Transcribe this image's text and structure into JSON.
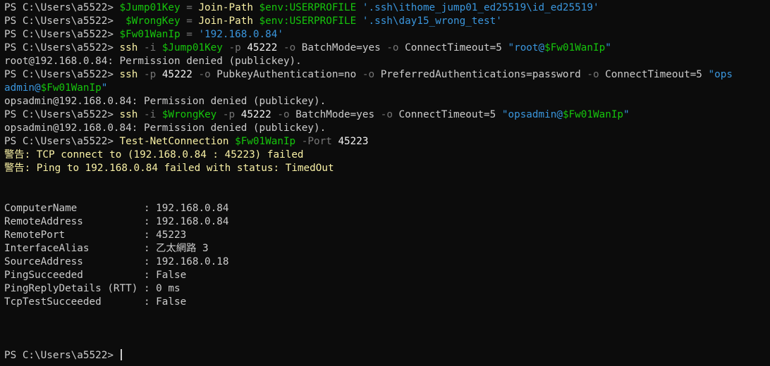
{
  "colors": {
    "background": "#0c0c0c",
    "default": "#cccccc",
    "command": "#f9f1a5",
    "variable": "#16c60c",
    "string": "#3a96dd",
    "operator": "#767676",
    "warning": "#f9f1a5",
    "number": "#f2f2f2"
  },
  "lines": [
    {
      "segs": [
        {
          "t": "PS C:\\Users\\a5522> ",
          "c": "default"
        },
        {
          "t": "$Jump01Key",
          "c": "variable"
        },
        {
          "t": " ",
          "c": "default"
        },
        {
          "t": "=",
          "c": "operator"
        },
        {
          "t": " ",
          "c": "default"
        },
        {
          "t": "Join-Path",
          "c": "command"
        },
        {
          "t": " ",
          "c": "default"
        },
        {
          "t": "$env:USERPROFILE",
          "c": "variable"
        },
        {
          "t": " ",
          "c": "default"
        },
        {
          "t": "'.ssh\\ithome_jump01_ed25519\\id_ed25519'",
          "c": "string"
        }
      ]
    },
    {
      "segs": [
        {
          "t": "PS C:\\Users\\a5522>  ",
          "c": "default"
        },
        {
          "t": "$WrongKey",
          "c": "variable"
        },
        {
          "t": " ",
          "c": "default"
        },
        {
          "t": "=",
          "c": "operator"
        },
        {
          "t": " ",
          "c": "default"
        },
        {
          "t": "Join-Path",
          "c": "command"
        },
        {
          "t": " ",
          "c": "default"
        },
        {
          "t": "$env:USERPROFILE",
          "c": "variable"
        },
        {
          "t": " ",
          "c": "default"
        },
        {
          "t": "'.ssh\\day15_wrong_test'",
          "c": "string"
        }
      ]
    },
    {
      "segs": [
        {
          "t": "PS C:\\Users\\a5522> ",
          "c": "default"
        },
        {
          "t": "$Fw01WanIp",
          "c": "variable"
        },
        {
          "t": " ",
          "c": "default"
        },
        {
          "t": "=",
          "c": "operator"
        },
        {
          "t": " ",
          "c": "default"
        },
        {
          "t": "'192.168.0.84'",
          "c": "string"
        }
      ]
    },
    {
      "segs": [
        {
          "t": "PS C:\\Users\\a5522> ",
          "c": "default"
        },
        {
          "t": "ssh",
          "c": "command"
        },
        {
          "t": " ",
          "c": "default"
        },
        {
          "t": "-i",
          "c": "operator"
        },
        {
          "t": " ",
          "c": "default"
        },
        {
          "t": "$Jump01Key",
          "c": "variable"
        },
        {
          "t": " ",
          "c": "default"
        },
        {
          "t": "-p",
          "c": "operator"
        },
        {
          "t": " ",
          "c": "default"
        },
        {
          "t": "45222",
          "c": "number"
        },
        {
          "t": " ",
          "c": "default"
        },
        {
          "t": "-o",
          "c": "operator"
        },
        {
          "t": " BatchMode=yes ",
          "c": "default"
        },
        {
          "t": "-o",
          "c": "operator"
        },
        {
          "t": " ConnectTimeout=5 ",
          "c": "default"
        },
        {
          "t": "\"root@",
          "c": "string"
        },
        {
          "t": "$Fw01WanIp",
          "c": "variable"
        },
        {
          "t": "\"",
          "c": "string"
        }
      ]
    },
    {
      "segs": [
        {
          "t": "root@192.168.0.84: Permission denied (publickey).",
          "c": "default"
        }
      ]
    },
    {
      "segs": [
        {
          "t": "PS C:\\Users\\a5522> ",
          "c": "default"
        },
        {
          "t": "ssh",
          "c": "command"
        },
        {
          "t": " ",
          "c": "default"
        },
        {
          "t": "-p",
          "c": "operator"
        },
        {
          "t": " ",
          "c": "default"
        },
        {
          "t": "45222",
          "c": "number"
        },
        {
          "t": " ",
          "c": "default"
        },
        {
          "t": "-o",
          "c": "operator"
        },
        {
          "t": " PubkeyAuthentication=no ",
          "c": "default"
        },
        {
          "t": "-o",
          "c": "operator"
        },
        {
          "t": " PreferredAuthentications=password ",
          "c": "default"
        },
        {
          "t": "-o",
          "c": "operator"
        },
        {
          "t": " ConnectTimeout=5 ",
          "c": "default"
        },
        {
          "t": "\"ops",
          "c": "string"
        }
      ]
    },
    {
      "segs": [
        {
          "t": "admin@",
          "c": "string"
        },
        {
          "t": "$Fw01WanIp",
          "c": "variable"
        },
        {
          "t": "\"",
          "c": "string"
        }
      ]
    },
    {
      "segs": [
        {
          "t": "opsadmin@192.168.0.84: Permission denied (publickey).",
          "c": "default"
        }
      ]
    },
    {
      "segs": [
        {
          "t": "PS C:\\Users\\a5522> ",
          "c": "default"
        },
        {
          "t": "ssh",
          "c": "command"
        },
        {
          "t": " ",
          "c": "default"
        },
        {
          "t": "-i",
          "c": "operator"
        },
        {
          "t": " ",
          "c": "default"
        },
        {
          "t": "$WrongKey",
          "c": "variable"
        },
        {
          "t": " ",
          "c": "default"
        },
        {
          "t": "-p",
          "c": "operator"
        },
        {
          "t": " ",
          "c": "default"
        },
        {
          "t": "45222",
          "c": "number"
        },
        {
          "t": " ",
          "c": "default"
        },
        {
          "t": "-o",
          "c": "operator"
        },
        {
          "t": " BatchMode=yes ",
          "c": "default"
        },
        {
          "t": "-o",
          "c": "operator"
        },
        {
          "t": " ConnectTimeout=5 ",
          "c": "default"
        },
        {
          "t": "\"opsadmin@",
          "c": "string"
        },
        {
          "t": "$Fw01WanIp",
          "c": "variable"
        },
        {
          "t": "\"",
          "c": "string"
        }
      ]
    },
    {
      "segs": [
        {
          "t": "opsadmin@192.168.0.84: Permission denied (publickey).",
          "c": "default"
        }
      ]
    },
    {
      "segs": [
        {
          "t": "PS C:\\Users\\a5522> ",
          "c": "default"
        },
        {
          "t": "Test-NetConnection",
          "c": "command"
        },
        {
          "t": " ",
          "c": "default"
        },
        {
          "t": "$Fw01WanIp",
          "c": "variable"
        },
        {
          "t": " ",
          "c": "default"
        },
        {
          "t": "-Port",
          "c": "operator"
        },
        {
          "t": " ",
          "c": "default"
        },
        {
          "t": "45223",
          "c": "number"
        }
      ]
    },
    {
      "segs": [
        {
          "t": "警告: TCP connect to (192.168.0.84 : 45223) failed",
          "c": "warning"
        }
      ]
    },
    {
      "segs": [
        {
          "t": "警告: Ping to 192.168.0.84 failed with status: TimedOut",
          "c": "warning"
        }
      ]
    },
    {
      "segs": []
    },
    {
      "segs": []
    },
    {
      "segs": [
        {
          "t": "ComputerName           : 192.168.0.84",
          "c": "default"
        }
      ]
    },
    {
      "segs": [
        {
          "t": "RemoteAddress          : 192.168.0.84",
          "c": "default"
        }
      ]
    },
    {
      "segs": [
        {
          "t": "RemotePort             : 45223",
          "c": "default"
        }
      ]
    },
    {
      "segs": [
        {
          "t": "InterfaceAlias         : 乙太網路 3",
          "c": "default"
        }
      ]
    },
    {
      "segs": [
        {
          "t": "SourceAddress          : 192.168.0.18",
          "c": "default"
        }
      ]
    },
    {
      "segs": [
        {
          "t": "PingSucceeded          : False",
          "c": "default"
        }
      ]
    },
    {
      "segs": [
        {
          "t": "PingReplyDetails (RTT) : 0 ms",
          "c": "default"
        }
      ]
    },
    {
      "segs": [
        {
          "t": "TcpTestSucceeded       : False",
          "c": "default"
        }
      ]
    },
    {
      "segs": []
    },
    {
      "segs": []
    },
    {
      "segs": []
    },
    {
      "segs": [
        {
          "t": "PS C:\\Users\\a5522> ",
          "c": "default"
        }
      ],
      "cursor": true
    }
  ]
}
